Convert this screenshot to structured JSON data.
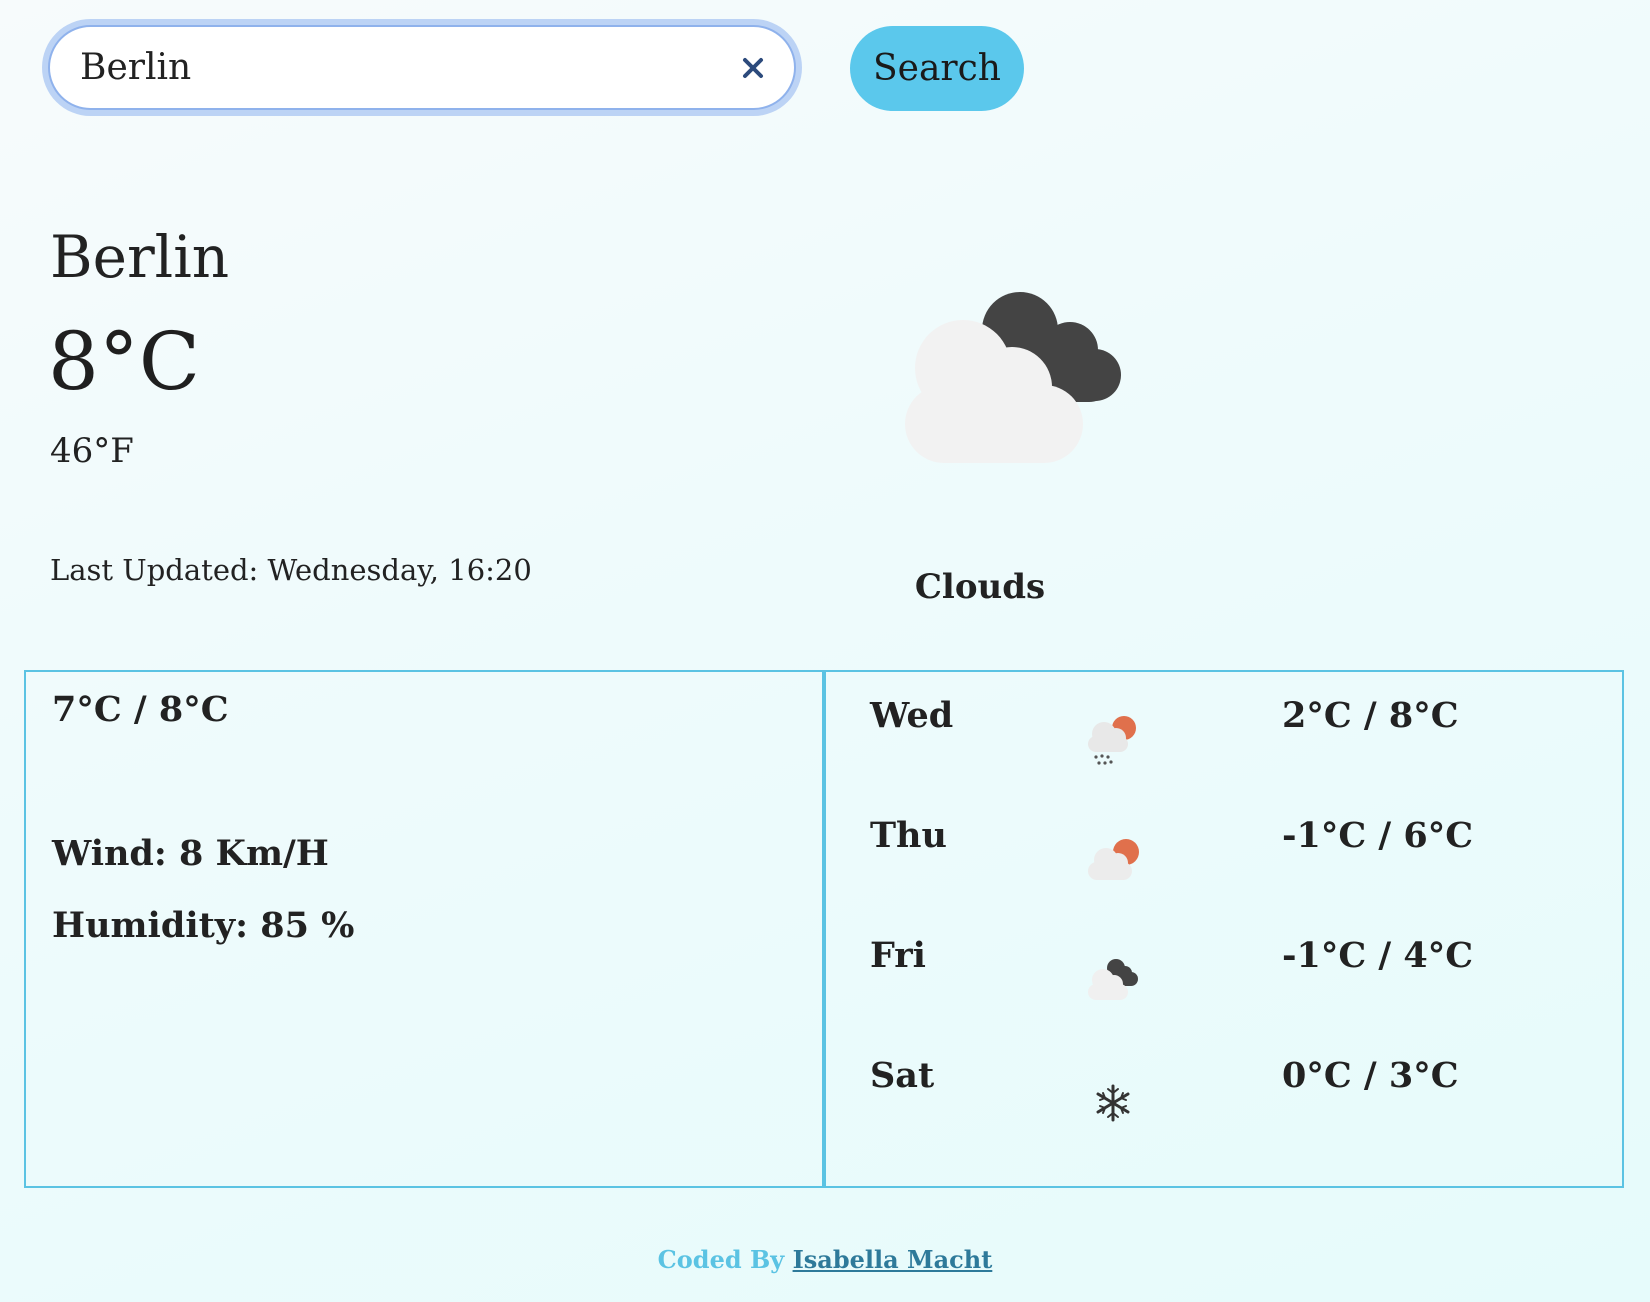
{
  "search": {
    "value": "Berlin",
    "button_label": "Search"
  },
  "current": {
    "city": "Berlin",
    "temp_c": "8°C",
    "temp_f": "46°F",
    "last_updated": "Last Updated: Wednesday, 16:20",
    "description": "Clouds",
    "icon": "broken-clouds-icon"
  },
  "today": {
    "min_max": "7°C / 8°C",
    "wind": "Wind: 8 Km/H",
    "humidity": "Humidity: 85 %"
  },
  "forecast": [
    {
      "day": "Wed",
      "icon": "rain-sun-icon",
      "temp": "2°C / 8°C"
    },
    {
      "day": "Thu",
      "icon": "partly-cloudy-icon",
      "temp": "-1°C / 6°C"
    },
    {
      "day": "Fri",
      "icon": "broken-clouds-icon",
      "temp": "-1°C / 4°C"
    },
    {
      "day": "Sat",
      "icon": "snowflake-icon",
      "temp": "0°C / 3°C"
    }
  ],
  "footer": {
    "prefix": "Coded By",
    "author": "Isabella Macht"
  },
  "colors": {
    "accent": "#5bc8ec",
    "border": "#5bc3e3",
    "sun": "#e0704c",
    "dark_cloud": "#444444",
    "light_cloud": "#f2f2f2"
  }
}
